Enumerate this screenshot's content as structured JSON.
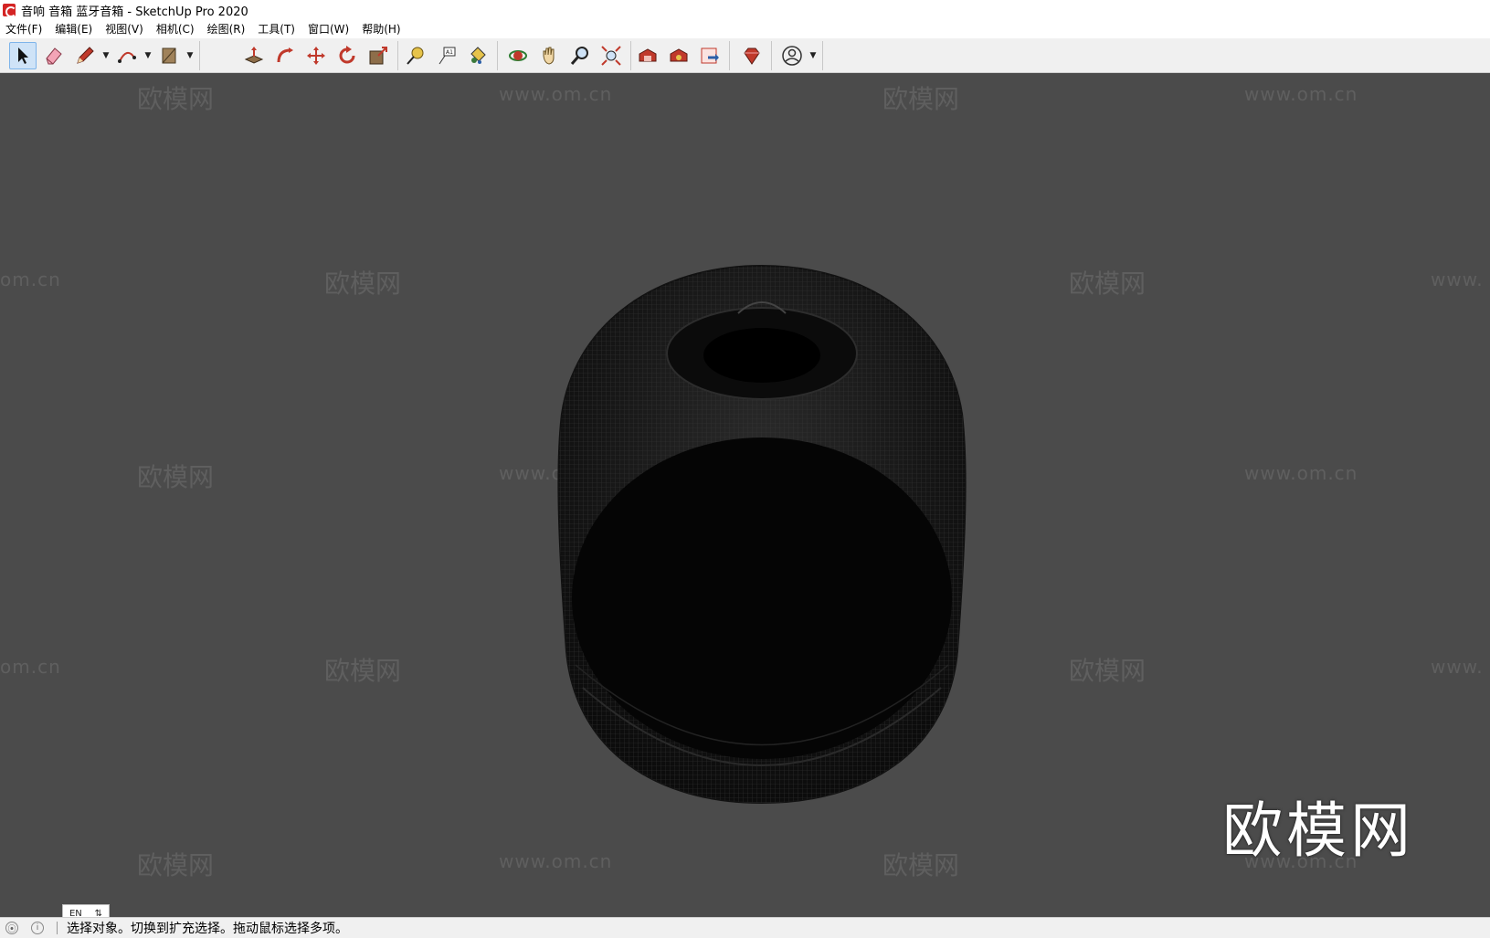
{
  "window": {
    "title": "音响 音箱 蓝牙音箱 - SketchUp Pro 2020"
  },
  "menubar": {
    "items": [
      "文件(F)",
      "编辑(E)",
      "视图(V)",
      "相机(C)",
      "绘图(R)",
      "工具(T)",
      "窗口(W)",
      "帮助(H)"
    ]
  },
  "toolbar": {
    "tools": [
      {
        "icon": "select-arrow-icon",
        "active": true
      },
      {
        "icon": "eraser-icon"
      },
      {
        "icon": "pencil-line-icon"
      },
      {
        "icon": "arc-icon"
      },
      {
        "icon": "rectangle-shape-icon"
      },
      {
        "icon": "push-pull-icon"
      },
      {
        "icon": "follow-me-icon"
      },
      {
        "icon": "move-icon"
      },
      {
        "icon": "rotate-icon"
      },
      {
        "icon": "scale-icon"
      },
      {
        "icon": "tape-measure-icon"
      },
      {
        "icon": "text-icon"
      },
      {
        "icon": "paint-bucket-icon"
      },
      {
        "icon": "orbit-icon"
      },
      {
        "icon": "pan-icon"
      },
      {
        "icon": "zoom-icon"
      },
      {
        "icon": "zoom-extents-icon"
      },
      {
        "icon": "warehouse-icon"
      },
      {
        "icon": "extension-warehouse-icon"
      },
      {
        "icon": "layout-send-icon"
      },
      {
        "icon": "ruby-extension-icon"
      },
      {
        "icon": "account-icon"
      }
    ]
  },
  "viewport": {
    "watermark_cn": "欧模网",
    "watermark_url": "www.om.cn",
    "watermark_partial_left": "om.cn",
    "watermark_partial_right": "www.",
    "brand_logo": "欧模网",
    "background_color": "#4b4b4b"
  },
  "statusbar": {
    "hint": "选择对象。切换到扩充选择。拖动鼠标选择多项。",
    "ime_label": "EN"
  }
}
